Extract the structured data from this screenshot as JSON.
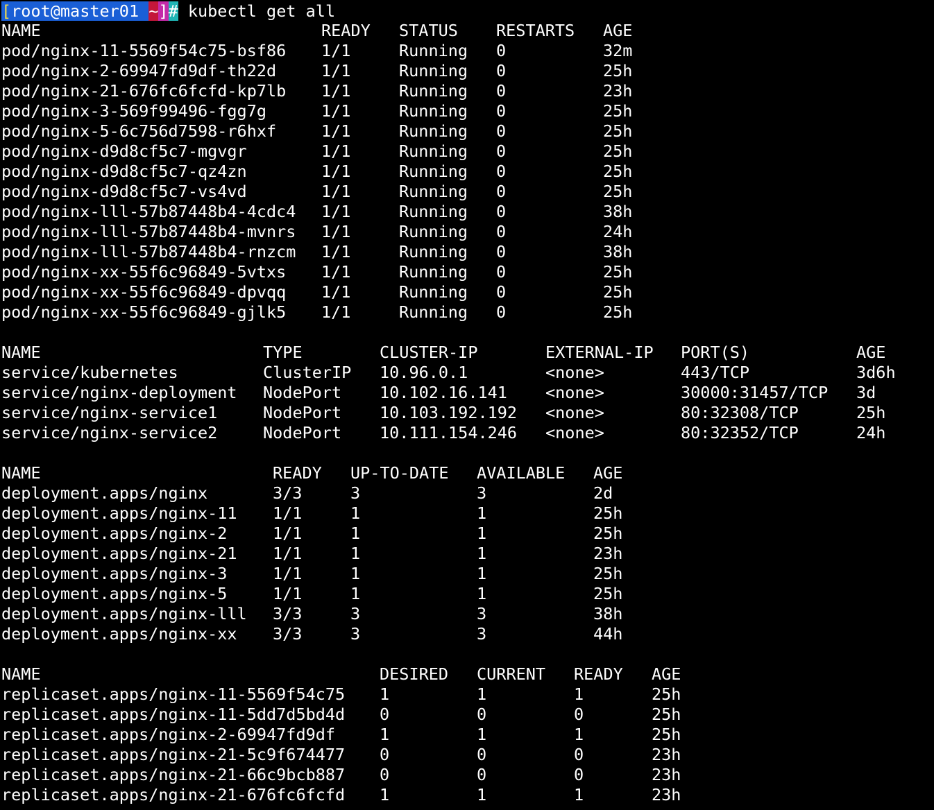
{
  "prompt": {
    "open_bracket": "[",
    "user": "root",
    "at": "@",
    "host": "master01",
    "space": " ",
    "dir": "~",
    "close_bracket": "]",
    "symbol": "#",
    "command": " kubectl get all"
  },
  "pods": {
    "headers": [
      "NAME",
      "READY",
      "STATUS",
      "RESTARTS",
      "AGE"
    ],
    "rows": [
      [
        "pod/nginx-11-5569f54c75-bsf86",
        "1/1",
        "Running",
        "0",
        "32m"
      ],
      [
        "pod/nginx-2-69947fd9df-th22d",
        "1/1",
        "Running",
        "0",
        "25h"
      ],
      [
        "pod/nginx-21-676fc6fcfd-kp7lb",
        "1/1",
        "Running",
        "0",
        "23h"
      ],
      [
        "pod/nginx-3-569f99496-fgg7g",
        "1/1",
        "Running",
        "0",
        "25h"
      ],
      [
        "pod/nginx-5-6c756d7598-r6hxf",
        "1/1",
        "Running",
        "0",
        "25h"
      ],
      [
        "pod/nginx-d9d8cf5c7-mgvgr",
        "1/1",
        "Running",
        "0",
        "25h"
      ],
      [
        "pod/nginx-d9d8cf5c7-qz4zn",
        "1/1",
        "Running",
        "0",
        "25h"
      ],
      [
        "pod/nginx-d9d8cf5c7-vs4vd",
        "1/1",
        "Running",
        "0",
        "25h"
      ],
      [
        "pod/nginx-lll-57b87448b4-4cdc4",
        "1/1",
        "Running",
        "0",
        "38h"
      ],
      [
        "pod/nginx-lll-57b87448b4-mvnrs",
        "1/1",
        "Running",
        "0",
        "24h"
      ],
      [
        "pod/nginx-lll-57b87448b4-rnzcm",
        "1/1",
        "Running",
        "0",
        "38h"
      ],
      [
        "pod/nginx-xx-55f6c96849-5vtxs",
        "1/1",
        "Running",
        "0",
        "25h"
      ],
      [
        "pod/nginx-xx-55f6c96849-dpvqq",
        "1/1",
        "Running",
        "0",
        "25h"
      ],
      [
        "pod/nginx-xx-55f6c96849-gjlk5",
        "1/1",
        "Running",
        "0",
        "25h"
      ]
    ]
  },
  "services": {
    "headers": [
      "NAME",
      "TYPE",
      "CLUSTER-IP",
      "EXTERNAL-IP",
      "PORT(S)",
      "AGE"
    ],
    "rows": [
      [
        "service/kubernetes",
        "ClusterIP",
        "10.96.0.1",
        "<none>",
        "443/TCP",
        "3d6h"
      ],
      [
        "service/nginx-deployment",
        "NodePort",
        "10.102.16.141",
        "<none>",
        "30000:31457/TCP",
        "3d"
      ],
      [
        "service/nginx-service1",
        "NodePort",
        "10.103.192.192",
        "<none>",
        "80:32308/TCP",
        "25h"
      ],
      [
        "service/nginx-service2",
        "NodePort",
        "10.111.154.246",
        "<none>",
        "80:32352/TCP",
        "24h"
      ]
    ]
  },
  "deployments": {
    "headers": [
      "NAME",
      "READY",
      "UP-TO-DATE",
      "AVAILABLE",
      "AGE"
    ],
    "rows": [
      [
        "deployment.apps/nginx",
        "3/3",
        "3",
        "3",
        "2d"
      ],
      [
        "deployment.apps/nginx-11",
        "1/1",
        "1",
        "1",
        "25h"
      ],
      [
        "deployment.apps/nginx-2",
        "1/1",
        "1",
        "1",
        "25h"
      ],
      [
        "deployment.apps/nginx-21",
        "1/1",
        "1",
        "1",
        "23h"
      ],
      [
        "deployment.apps/nginx-3",
        "1/1",
        "1",
        "1",
        "25h"
      ],
      [
        "deployment.apps/nginx-5",
        "1/1",
        "1",
        "1",
        "25h"
      ],
      [
        "deployment.apps/nginx-lll",
        "3/3",
        "3",
        "3",
        "38h"
      ],
      [
        "deployment.apps/nginx-xx",
        "3/3",
        "3",
        "3",
        "44h"
      ]
    ]
  },
  "replicasets": {
    "headers": [
      "NAME",
      "DESIRED",
      "CURRENT",
      "READY",
      "AGE"
    ],
    "rows": [
      [
        "replicaset.apps/nginx-11-5569f54c75",
        "1",
        "1",
        "1",
        "25h"
      ],
      [
        "replicaset.apps/nginx-11-5dd7d5bd4d",
        "0",
        "0",
        "0",
        "25h"
      ],
      [
        "replicaset.apps/nginx-2-69947fd9df",
        "1",
        "1",
        "1",
        "25h"
      ],
      [
        "replicaset.apps/nginx-21-5c9f674477",
        "0",
        "0",
        "0",
        "23h"
      ],
      [
        "replicaset.apps/nginx-21-66c9bcb887",
        "0",
        "0",
        "0",
        "23h"
      ],
      [
        "replicaset.apps/nginx-21-676fc6fcfd",
        "1",
        "1",
        "1",
        "23h"
      ]
    ]
  }
}
